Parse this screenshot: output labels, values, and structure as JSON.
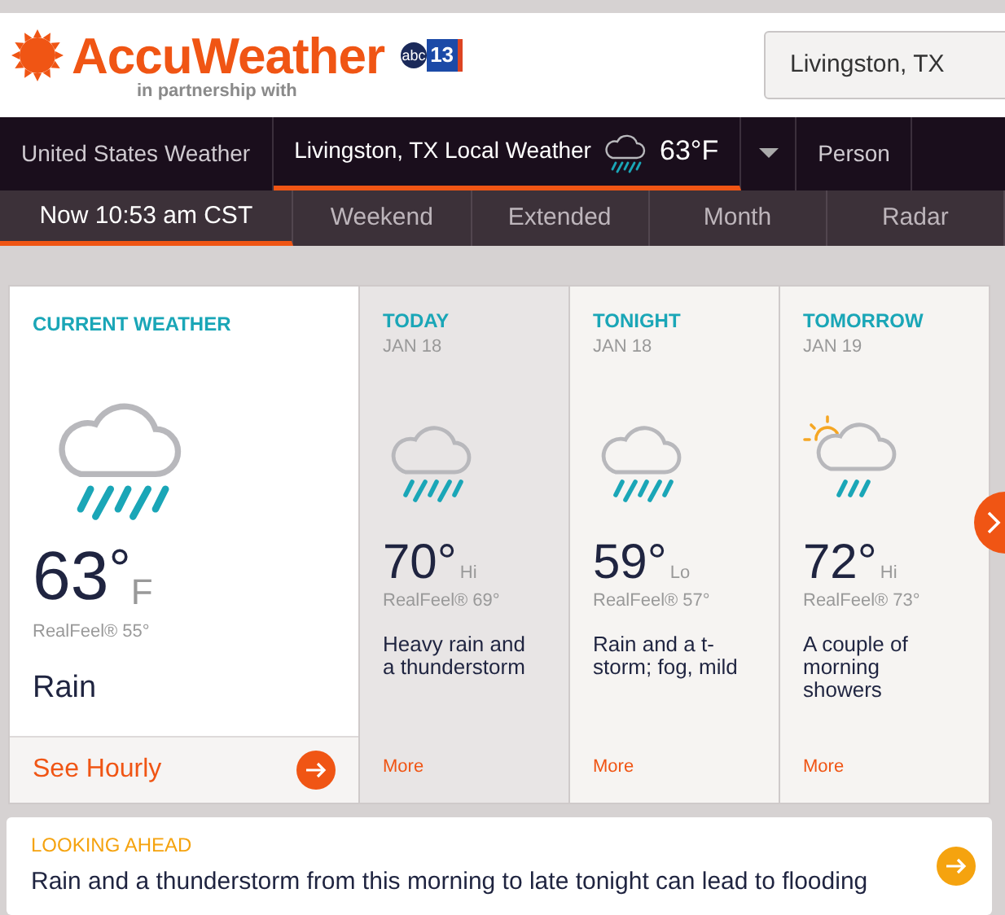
{
  "header": {
    "brand": "AccuWeather",
    "tagline": "in partnership with",
    "partner_logo": {
      "text_1": "abc",
      "text_2": "13"
    },
    "location_field": {
      "value": "Livingston, TX"
    }
  },
  "nav": [
    {
      "label": "United States Weather",
      "selected": false
    },
    {
      "label": "Livingston, TX Local Weather",
      "selected": true,
      "temp": "63°F"
    },
    {
      "label": "Person",
      "selected": false
    }
  ],
  "subnav": [
    {
      "label": "Now 10:53 am CST",
      "selected": true
    },
    {
      "label": "Weekend",
      "selected": false
    },
    {
      "label": "Extended",
      "selected": false
    },
    {
      "label": "Month",
      "selected": false
    },
    {
      "label": "Radar",
      "selected": false
    }
  ],
  "current": {
    "title": "CURRENT WEATHER",
    "temp": "63",
    "degree": "°",
    "unit": "F",
    "realfeel": "RealFeel® 55°",
    "condition": "Rain",
    "link": "See Hourly"
  },
  "forecast": [
    {
      "title": "TODAY",
      "date": "JAN 18",
      "kind": "rain",
      "temp": "70°",
      "hilo": "Hi",
      "realfeel": "RealFeel® 69°",
      "text": "Heavy rain and a thunderstorm",
      "link": "More",
      "selected": true
    },
    {
      "title": "TONIGHT",
      "date": "JAN 18",
      "kind": "rain",
      "temp": "59°",
      "hilo": "Lo",
      "realfeel": "RealFeel® 57°",
      "text": "Rain and a t-storm; fog, mild",
      "link": "More",
      "selected": false
    },
    {
      "title": "TOMORROW",
      "date": "JAN 19",
      "kind": "sun-rain",
      "temp": "72°",
      "hilo": "Hi",
      "realfeel": "RealFeel® 73°",
      "text": "A couple of morning showers",
      "link": "More",
      "selected": false
    }
  ],
  "looking_ahead": {
    "title": "LOOKING AHEAD",
    "text": "Rain and a thunderstorm from this morning to late tonight can lead to flooding"
  }
}
